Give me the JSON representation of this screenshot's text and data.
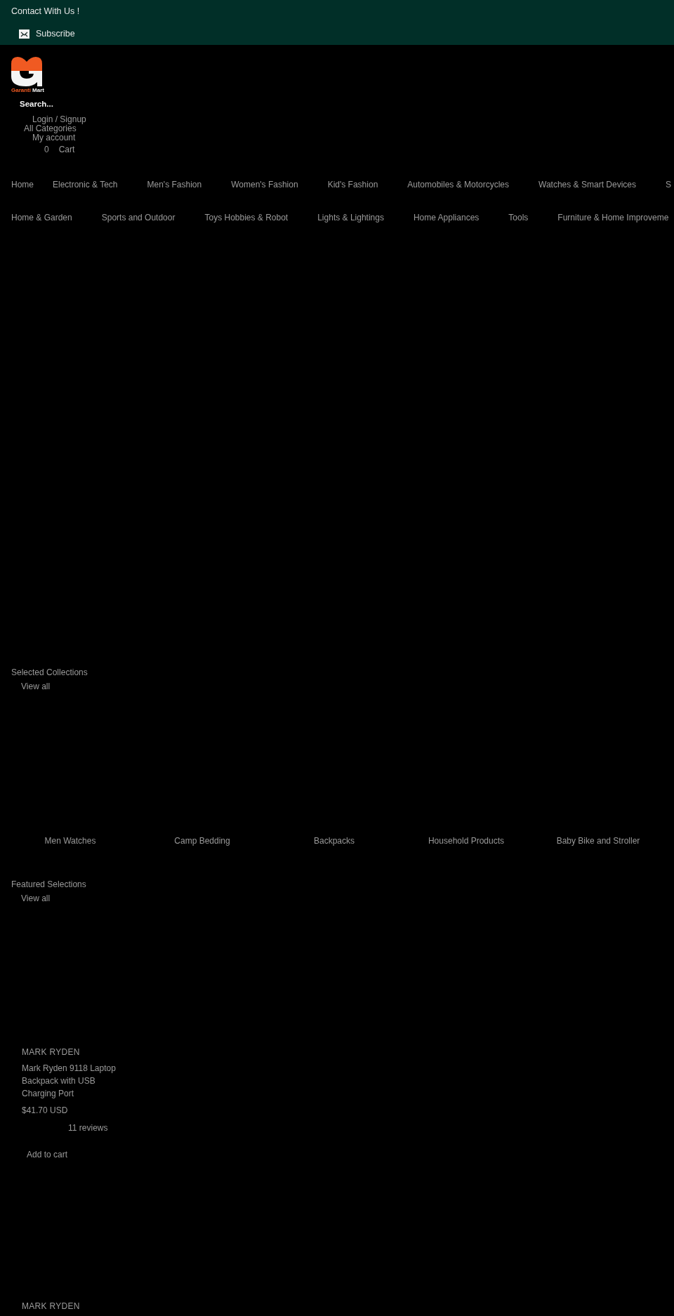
{
  "top_bar": {
    "contact": "Contact With Us !",
    "subscribe": "Subscribe"
  },
  "logo": {
    "words": [
      "Garanti",
      "Mart"
    ]
  },
  "search": {
    "placeholder": "Search..."
  },
  "account": {
    "login": "Login / Signup",
    "categories": "All Categories",
    "my_account": "My account",
    "cart_count": "0",
    "cart": "Cart"
  },
  "nav_rows": [
    [
      "Home",
      "Electronic & Tech",
      "Men's Fashion",
      "Women's Fashion",
      "Kid's Fashion",
      "Automobiles & Motorcycles",
      "Watches & Smart Devices",
      "S"
    ],
    [
      "Home & Garden",
      "Sports and Outdoor",
      "Toys Hobbies & Robot",
      "Lights & Lightings",
      "Home Appliances",
      "Tools",
      "Furniture & Home Improveme"
    ]
  ],
  "selected_collections": {
    "title": "Selected Collections",
    "link": "View all",
    "collections": [
      "Men Watches",
      "Camp Bedding",
      "Backpacks",
      "Household Products",
      "Baby Bike and Stroller"
    ]
  },
  "featured_selections": {
    "title": "Featured Selections",
    "link": "View all",
    "products": [
      {
        "brand": "MARK RYDEN",
        "title": "Mark Ryden 9118 Laptop Backpack with USB Charging Port",
        "price": "$41.70 USD",
        "reviews": "11 reviews",
        "button": "Add to cart"
      },
      {
        "brand": "MARK RYDEN"
      }
    ]
  }
}
